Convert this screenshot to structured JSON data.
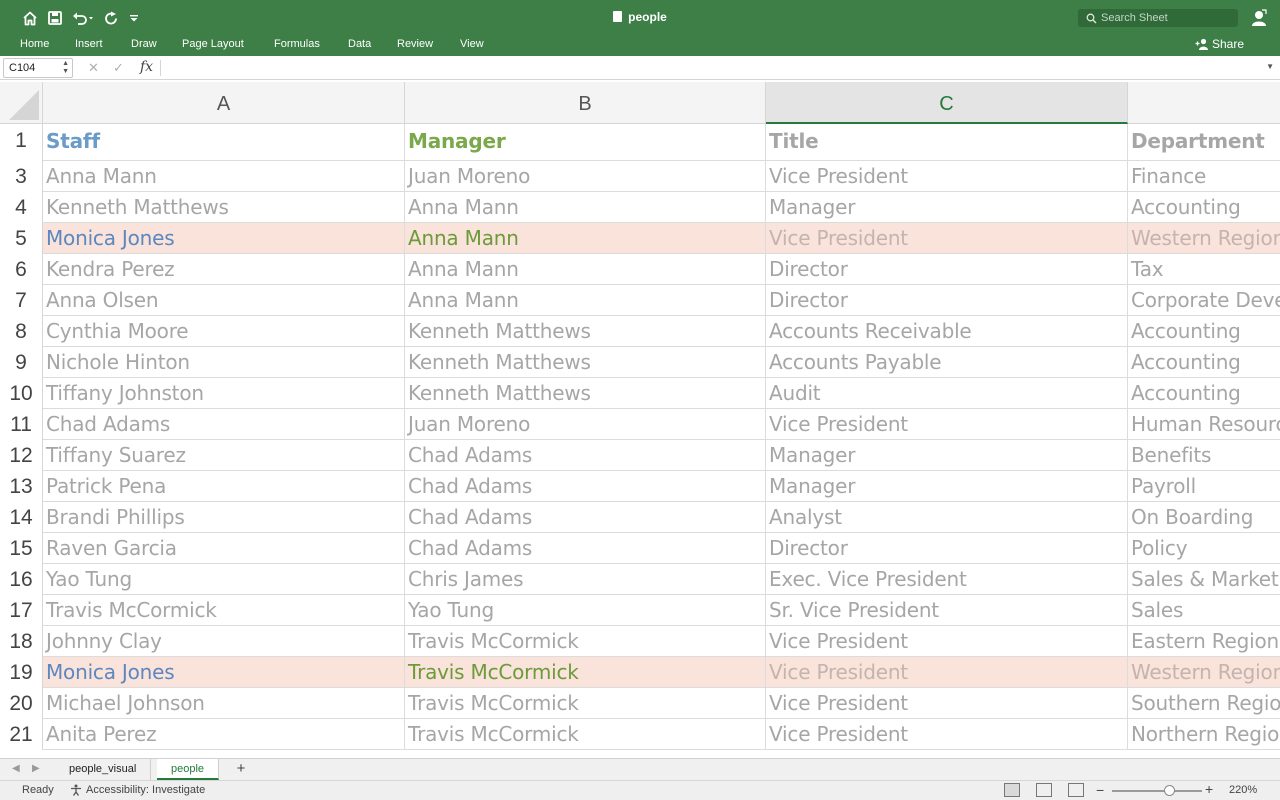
{
  "app": {
    "title": "people"
  },
  "quick_access": {
    "icons": [
      "home-icon",
      "save-icon",
      "undo-icon",
      "redo-icon",
      "customize-icon"
    ]
  },
  "search": {
    "placeholder": "Search Sheet"
  },
  "ribbon": {
    "tabs": [
      "Home",
      "Insert",
      "Draw",
      "Page Layout",
      "Formulas",
      "Data",
      "Review",
      "View"
    ],
    "share_label": "Share"
  },
  "formula_bar": {
    "name_box": "C104",
    "fx_label": "fx",
    "value": ""
  },
  "columns": [
    "A",
    "B",
    "C"
  ],
  "selected_column": "C",
  "rows": [
    {
      "num": "1",
      "a": "Staff",
      "b": "Manager",
      "c": "Title",
      "d": "Department",
      "highlight": false,
      "header": true
    },
    {
      "num": "3",
      "a": "Anna Mann",
      "b": "Juan Moreno",
      "c": "Vice President",
      "d": "Finance",
      "highlight": false
    },
    {
      "num": "4",
      "a": "Kenneth Matthews",
      "b": "Anna Mann",
      "c": "Manager",
      "d": "Accounting",
      "highlight": false
    },
    {
      "num": "5",
      "a": "Monica Jones",
      "b": "Anna Mann",
      "c": "Vice President",
      "d": "Western Region",
      "highlight": true
    },
    {
      "num": "6",
      "a": "Kendra Perez",
      "b": "Anna Mann",
      "c": "Director",
      "d": "Tax",
      "highlight": false
    },
    {
      "num": "7",
      "a": "Anna Olsen",
      "b": "Anna Mann",
      "c": "Director",
      "d": "Corporate Development",
      "highlight": false
    },
    {
      "num": "8",
      "a": "Cynthia Moore",
      "b": "Kenneth Matthews",
      "c": "Accounts Receivable",
      "d": "Accounting",
      "highlight": false
    },
    {
      "num": "9",
      "a": "Nichole Hinton",
      "b": "Kenneth Matthews",
      "c": "Accounts Payable",
      "d": "Accounting",
      "highlight": false
    },
    {
      "num": "10",
      "a": "Tiffany Johnston",
      "b": "Kenneth Matthews",
      "c": "Audit",
      "d": "Accounting",
      "highlight": false
    },
    {
      "num": "11",
      "a": "Chad Adams",
      "b": "Juan Moreno",
      "c": "Vice President",
      "d": "Human Resources",
      "highlight": false
    },
    {
      "num": "12",
      "a": "Tiffany Suarez",
      "b": "Chad Adams",
      "c": "Manager",
      "d": "Benefits",
      "highlight": false
    },
    {
      "num": "13",
      "a": "Patrick Pena",
      "b": "Chad Adams",
      "c": "Manager",
      "d": "Payroll",
      "highlight": false
    },
    {
      "num": "14",
      "a": "Brandi Phillips",
      "b": "Chad Adams",
      "c": "Analyst",
      "d": "On Boarding",
      "highlight": false
    },
    {
      "num": "15",
      "a": "Raven Garcia",
      "b": "Chad Adams",
      "c": "Director",
      "d": "Policy",
      "highlight": false
    },
    {
      "num": "16",
      "a": "Yao Tung",
      "b": "Chris James",
      "c": "Exec. Vice President",
      "d": "Sales & Marketing",
      "highlight": false
    },
    {
      "num": "17",
      "a": "Travis McCormick",
      "b": "Yao Tung",
      "c": "Sr. Vice President",
      "d": "Sales",
      "highlight": false
    },
    {
      "num": "18",
      "a": "Johnny Clay",
      "b": "Travis McCormick",
      "c": "Vice President",
      "d": "Eastern Region",
      "highlight": false
    },
    {
      "num": "19",
      "a": "Monica Jones",
      "b": "Travis McCormick",
      "c": "Vice President",
      "d": "Western Region",
      "highlight": true
    },
    {
      "num": "20",
      "a": "Michael Johnson",
      "b": "Travis McCormick",
      "c": "Vice President",
      "d": "Southern Region",
      "highlight": false
    },
    {
      "num": "21",
      "a": "Anita Perez",
      "b": "Travis McCormick",
      "c": "Vice President",
      "d": "Northern Region",
      "highlight": false
    }
  ],
  "sheets": {
    "tabs": [
      "people_visual",
      "people"
    ],
    "active": "people",
    "add_label": "+"
  },
  "status": {
    "ready": "Ready",
    "accessibility": "Accessibility: Investigate",
    "zoom": "220%",
    "zoom_minus": "−",
    "zoom_plus": "+"
  },
  "colors": {
    "accent": "#3d7f47",
    "highlight_row": "#f9e3da",
    "staff_blue": "#6b9bc8",
    "manager_green": "#7aa84a"
  }
}
